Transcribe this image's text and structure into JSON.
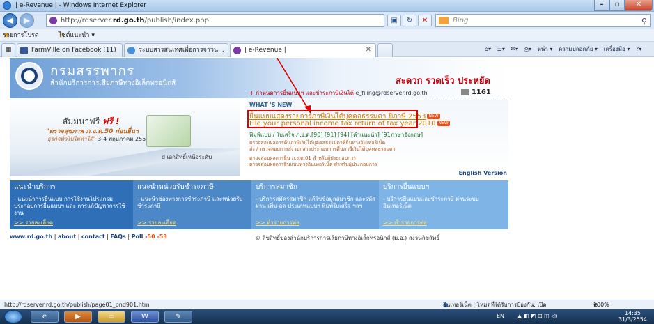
{
  "window": {
    "title": "| e-Revenue | - Windows Internet Explorer"
  },
  "address_bar": {
    "url_prefix": "http://rdserver.",
    "url_bold": "rd.go.th",
    "url_suffix": "/publish/index.php",
    "search_placeholder": "Bing"
  },
  "favorites": {
    "favorites_label": "รายการโปรด",
    "suggested_label": "ไซต์แนะนำ ▾"
  },
  "tabs": [
    {
      "label": "FarmVille on Facebook (11)"
    },
    {
      "label": "ระบบสารสนเทศเพื่อการจาวน..."
    },
    {
      "label": "| e-Revenue |"
    }
  ],
  "command_bar": {
    "page": "หน้า ▾",
    "safety": "ความปลอดภัย ▾",
    "tools": "เครื่องมือ ▾"
  },
  "site": {
    "org_name_th": "กรมสรรพากร",
    "org_sub_th": "สำนักบริการการเสียภาษีทางอิเล็กทรอนิกส์",
    "slogan": "สะดวก รวดเร็ว ประหยัด",
    "phone": "1161",
    "banner": {
      "free_line": "สัมมนาฟรี",
      "free_bold": "ฟรี !",
      "line2": "\"ตรวจสุขภาพ ภ.ง.ด.50 ก่อนยื่นฯ",
      "line3": "ธุรกิจทั่วไปไม่ทำได้\"",
      "line3_date": "3-4 พฤษภาคม 2554",
      "cut_text": "d เอกสิทธิ์เหนือระดับ"
    },
    "top_note_prefix": "+ กำหนดการยื่นแบบฯ และชำระภาษีเงินได้",
    "top_note_email": "e_filing@rdserver.rd.go.th",
    "whats_new": "WHAT 'S NEW",
    "headline_th": "ยื่นแบบแสดงรายการภาษีเงินได้บุคคลธรรมดา ปีภาษี 2553",
    "headline_en": "File your personal income tax return of tax year 2010",
    "new_tag": "NEW",
    "forms_line": "พิมพ์แบบ / ใบเสร็จ ภ.ง.ด.[90] [91] [94] [คำแนะนำ] [91ภาษาอังกฤษ]",
    "small_links": [
      "ตรวจสอบผลการคืนภาษีเงินได้บุคคลธรรมดาที่ยื่นทางอินเทอร์เน็ต",
      "ส่ง / ตรวจสอบการส่ง เอกสารประกอบการคืนภาษีเงินได้บุคคลธรรมดา",
      "ตรวจสอบผลการยื่น ภ.ง.ด.01 สำหรับผู้ประกอบการ",
      "ตรวจสอบผลการยื่นแบบทางอินเทอร์เน็ต สำหรับผู้ประกอบการ"
    ],
    "english_version": "English Version",
    "columns": [
      {
        "heading": "แนะนำบริการ",
        "body": "- แนะนำการยื่นแบบ การใช้งานโปรแกรมประกอบการยื่นแบบฯ และ การแก้ปัญหาการใช้งาน",
        "more": ">> รายละเอียด"
      },
      {
        "heading": "แนะนำหน่วยรับชำระภาษี",
        "body": "- แนะนำช่องทางการชำระภาษี และหน่วยรับชำระภาษี",
        "more": ">> รายละเอียด"
      },
      {
        "heading": "บริการสมาชิก",
        "body": "- บริการสมัครสมาชิก แก้ไขข้อมูลสมาชิก และรหัสผ่าน เพิ่ม-ลด ประเภทแบบฯ พิมพ์ใบเสร็จ ฯลฯ",
        "more": ">> ทำรายการต่อ"
      },
      {
        "heading": "บริการยื่นแบบฯ",
        "body": "- บริการยื่นแบบและชำระภาษี ผ่านระบบอินเทอร์เน็ต",
        "more": ">> ทำรายการต่อ"
      }
    ],
    "footer": {
      "site": "www.rd.go.th",
      "about": "about",
      "contact": "contact",
      "faqs": "FAQs",
      "poll_label": "Poll -",
      "poll_count": "50 -53",
      "copyright": "© ลิขสิทธิ์ของสำนักบริการการเสียภาษีทางอิเล็กทรอนิกส์ (ม.อ.) สงวนลิขสิทธิ์"
    }
  },
  "status_bar": {
    "url": "http://rdserver.rd.go.th/publish/page01_pnd901.htm",
    "zone": "อินเทอร์เน็ต | โหมดที่ได้รับการป้องกัน: เปิด",
    "zoom": "100%"
  },
  "taskbar": {
    "lang": "EN",
    "time": "14:35",
    "date": "31/3/2554"
  },
  "colors": {
    "annotation_red": "#e00000",
    "headline_orange": "#d07800",
    "blue_band": "#2e6fb8"
  }
}
